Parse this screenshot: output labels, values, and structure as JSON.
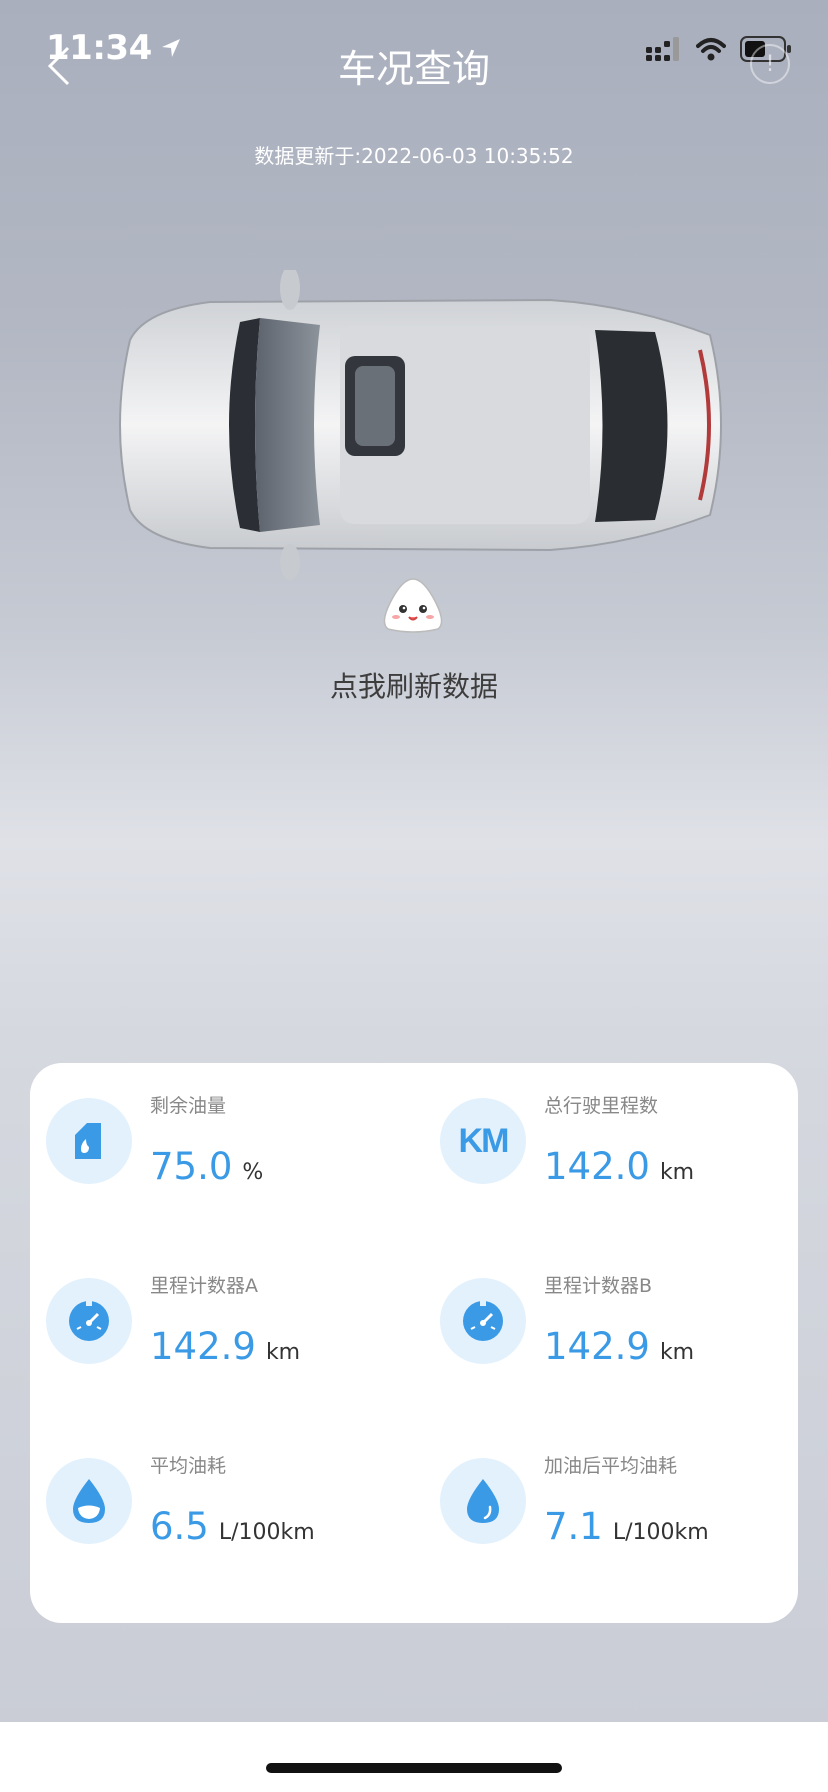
{
  "status": {
    "time": "11:34"
  },
  "nav": {
    "title": "车况查询"
  },
  "update_text": "数据更新于:2022-06-03 10:35:52",
  "refresh_label": "点我刷新数据",
  "metrics": [
    {
      "label": "剩余油量",
      "value": "75.0",
      "unit": "%",
      "icon": "fuel-can-icon"
    },
    {
      "label": "总行驶里程数",
      "value": "142.0",
      "unit": "km",
      "icon": "km-icon",
      "icon_text": "KM"
    },
    {
      "label": "里程计数器A",
      "value": "142.9",
      "unit": "km",
      "icon": "odometer-icon"
    },
    {
      "label": "里程计数器B",
      "value": "142.9",
      "unit": "km",
      "icon": "odometer-icon"
    },
    {
      "label": "平均油耗",
      "value": "6.5",
      "unit": "L/100km",
      "icon": "fuel-drop-icon"
    },
    {
      "label": "加油后平均油耗",
      "value": "7.1",
      "unit": "L/100km",
      "icon": "fuel-drop-icon"
    }
  ],
  "colors": {
    "accent": "#3a9ae6",
    "icon_bg": "#e3f1fd"
  }
}
